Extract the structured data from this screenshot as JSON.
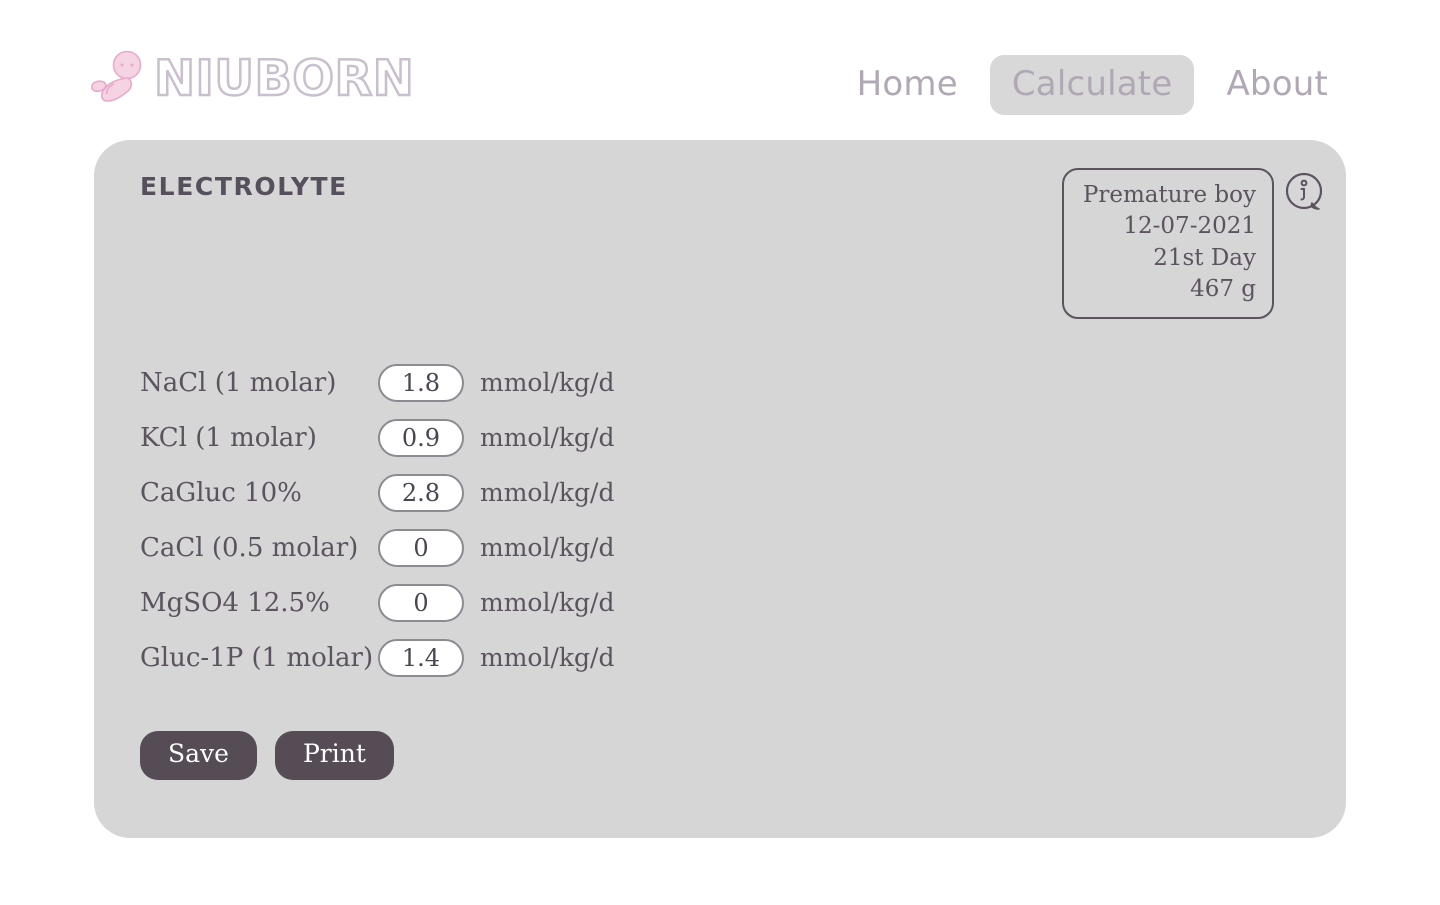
{
  "brand": {
    "name": "NIUBORN",
    "logo_icon": "baby-fetus-icon",
    "logo_color": "#f3c9dd",
    "text_outline_color": "#c9bfcd"
  },
  "nav": {
    "items": [
      {
        "label": "Home",
        "active": false
      },
      {
        "label": "Calculate",
        "active": true
      },
      {
        "label": "About",
        "active": false
      }
    ],
    "text_color": "#b1a8b5",
    "active_bg": "#d8d8d8"
  },
  "card": {
    "title": "ELECTROLYTE",
    "bg_color": "#d6d6d6",
    "text_color": "#5b545f"
  },
  "patient": {
    "info_icon": "info-speech-bubble-icon",
    "lines": [
      "Premature boy",
      "12-07-2021",
      "21st Day",
      "467 g"
    ]
  },
  "form": {
    "unit": "mmol/kg/d",
    "rows": [
      {
        "label": "NaCl (1 molar)",
        "value": "1.8",
        "unit": "mmol/kg/d"
      },
      {
        "label": "KCl (1 molar)",
        "value": "0.9",
        "unit": "mmol/kg/d"
      },
      {
        "label": "CaGluc 10%",
        "value": "2.8",
        "unit": "mmol/kg/d"
      },
      {
        "label": "CaCl (0.5 molar)",
        "value": "0",
        "unit": "mmol/kg/d"
      },
      {
        "label": "MgSO4 12.5%",
        "value": "0",
        "unit": "mmol/kg/d"
      },
      {
        "label": "Gluc-1P (1 molar)",
        "value": "1.4",
        "unit": "mmol/kg/d"
      }
    ]
  },
  "actions": {
    "save_label": "Save",
    "print_label": "Print",
    "button_color": "#554c56"
  }
}
